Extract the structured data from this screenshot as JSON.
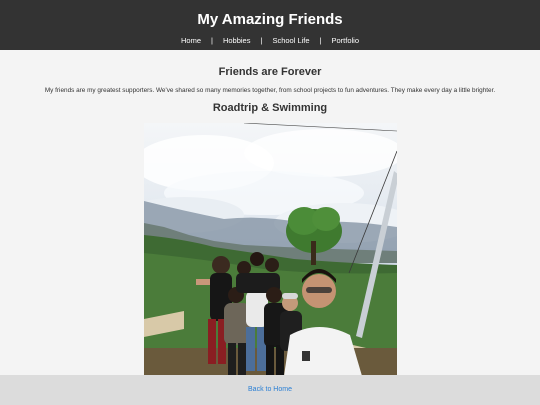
{
  "header": {
    "title": "My Amazing Friends",
    "nav": [
      {
        "label": "Home"
      },
      {
        "label": "Hobbies"
      },
      {
        "label": "School Life"
      },
      {
        "label": "Portfolio"
      }
    ],
    "separator": "|"
  },
  "main": {
    "section_title": "Friends are Forever",
    "intro": "My friends are my greatest supporters. We've shared so many memories together, from school projects to fun adventures. They make every day a little brighter.",
    "photo_title": "Roadtrip & Swimming"
  },
  "footer": {
    "back_link": "Back to Home"
  },
  "colors": {
    "header_bg": "#333333",
    "page_bg": "#f4f4f4",
    "footer_bg": "#dcdcdc",
    "link": "#2a7fd4"
  }
}
